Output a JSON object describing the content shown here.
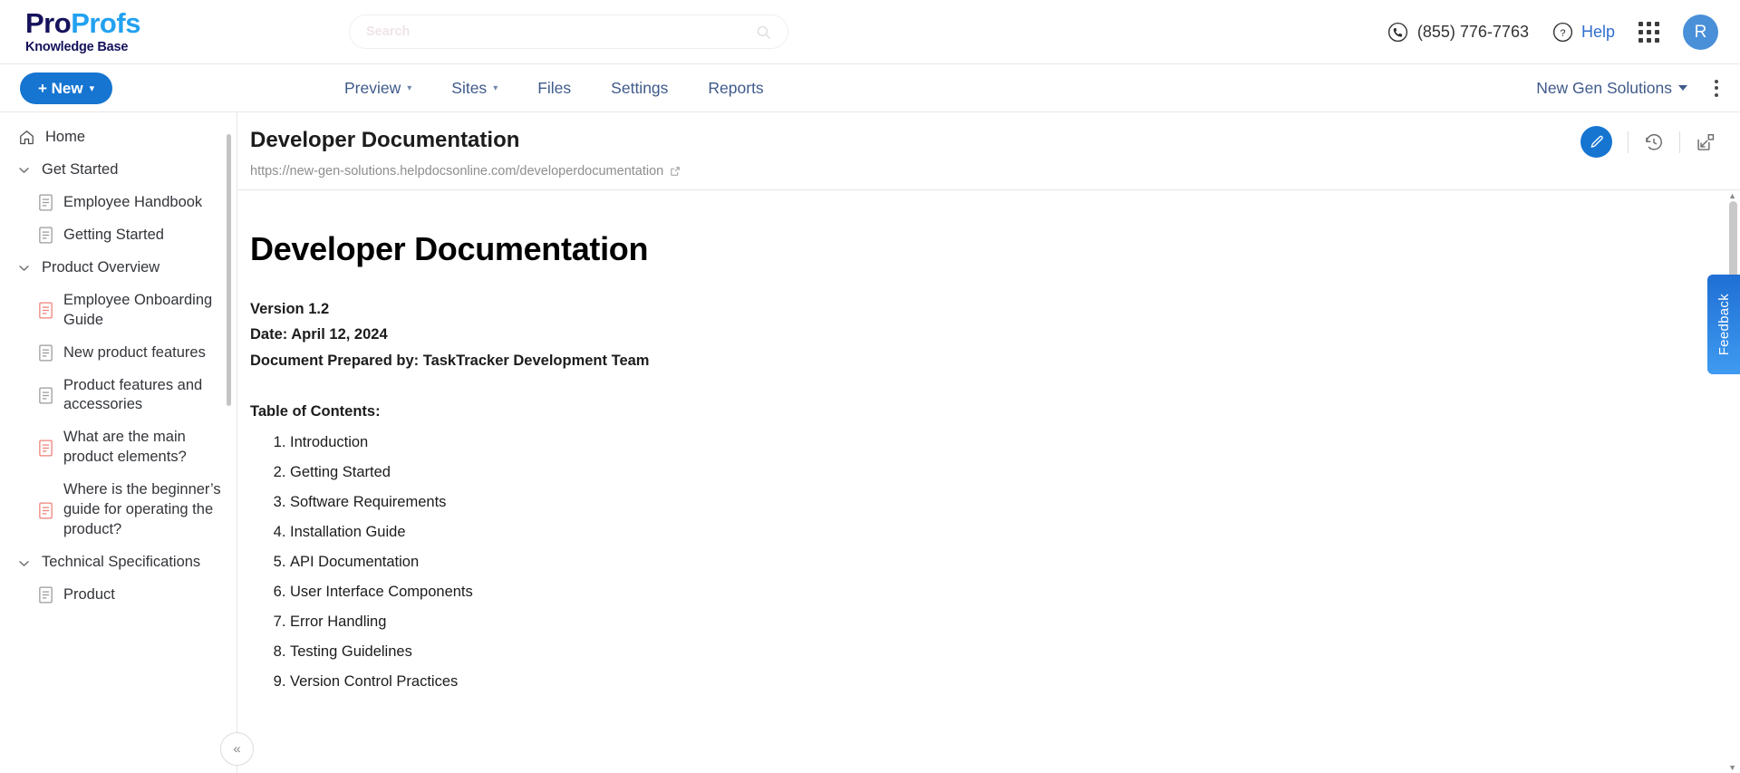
{
  "header": {
    "logo": {
      "part1": "Pro",
      "part2": "Profs",
      "subtitle": "Knowledge Base"
    },
    "search": {
      "placeholder": "Search",
      "value": "",
      "icon": "search-icon"
    },
    "phone": "(855) 776-7763",
    "help": "Help",
    "avatar_initial": "R",
    "icons": {
      "phone": "phone-icon",
      "help": "question-circle-icon",
      "apps": "apps-grid-icon"
    }
  },
  "nav": {
    "new_button": "+ New",
    "items": [
      {
        "label": "Preview",
        "has_caret": true
      },
      {
        "label": "Sites",
        "has_caret": true
      },
      {
        "label": "Files",
        "has_caret": false
      },
      {
        "label": "Settings",
        "has_caret": false
      },
      {
        "label": "Reports",
        "has_caret": false
      }
    ],
    "workspace": "New Gen Solutions",
    "overflow_icon": "kebab-menu-icon"
  },
  "sidebar": {
    "home": {
      "label": "Home",
      "icon": "home-icon"
    },
    "sections": [
      {
        "label": "Get Started",
        "expanded": true,
        "children": [
          {
            "label": "Employee Handbook",
            "icon": "document-icon",
            "state": "published"
          },
          {
            "label": "Getting Started",
            "icon": "document-icon",
            "state": "published"
          }
        ]
      },
      {
        "label": "Product Overview",
        "expanded": true,
        "children": [
          {
            "label": "Employee Onboarding Guide",
            "icon": "document-icon",
            "state": "draft"
          },
          {
            "label": "New product features",
            "icon": "document-icon",
            "state": "published"
          },
          {
            "label": "Product features and accessories",
            "icon": "document-icon",
            "state": "published"
          },
          {
            "label": "What are the main product elements?",
            "icon": "document-icon",
            "state": "draft"
          },
          {
            "label": "Where is the beginner’s guide for operating the product?",
            "icon": "document-icon",
            "state": "draft"
          }
        ]
      },
      {
        "label": "Technical Specifications",
        "expanded": true,
        "children": [
          {
            "label": "Product",
            "icon": "document-icon",
            "state": "published"
          }
        ]
      }
    ],
    "collapse_button": "«"
  },
  "content_header": {
    "title": "Developer Documentation",
    "url": "https://new-gen-solutions.helpdocsonline.com/developerdocumentation",
    "actions": [
      {
        "name": "edit-button",
        "icon": "pencil-icon"
      },
      {
        "name": "revision-history-button",
        "icon": "history-clock-icon"
      },
      {
        "name": "move-page-button",
        "icon": "move-page-icon"
      }
    ]
  },
  "document": {
    "heading": "Developer Documentation",
    "meta": [
      "Version 1.2",
      "Date: April 12, 2024",
      "Document Prepared by: TaskTracker Development Team"
    ],
    "toc_title": "Table of Contents:",
    "toc": [
      "Introduction",
      "Getting Started",
      "Software Requirements",
      "Installation Guide",
      "API Documentation",
      "User Interface Components",
      "Error Handling",
      "Testing Guidelines",
      "Version Control Practices"
    ]
  },
  "feedback": {
    "label": "Feedback"
  },
  "colors": {
    "brand_blue": "#1675d1",
    "logo_dark": "#16125c",
    "logo_light": "#22a1f0",
    "nav_text": "#3f5a8a",
    "draft_icon": "#ef8078",
    "published_icon": "#9a9a9a"
  }
}
